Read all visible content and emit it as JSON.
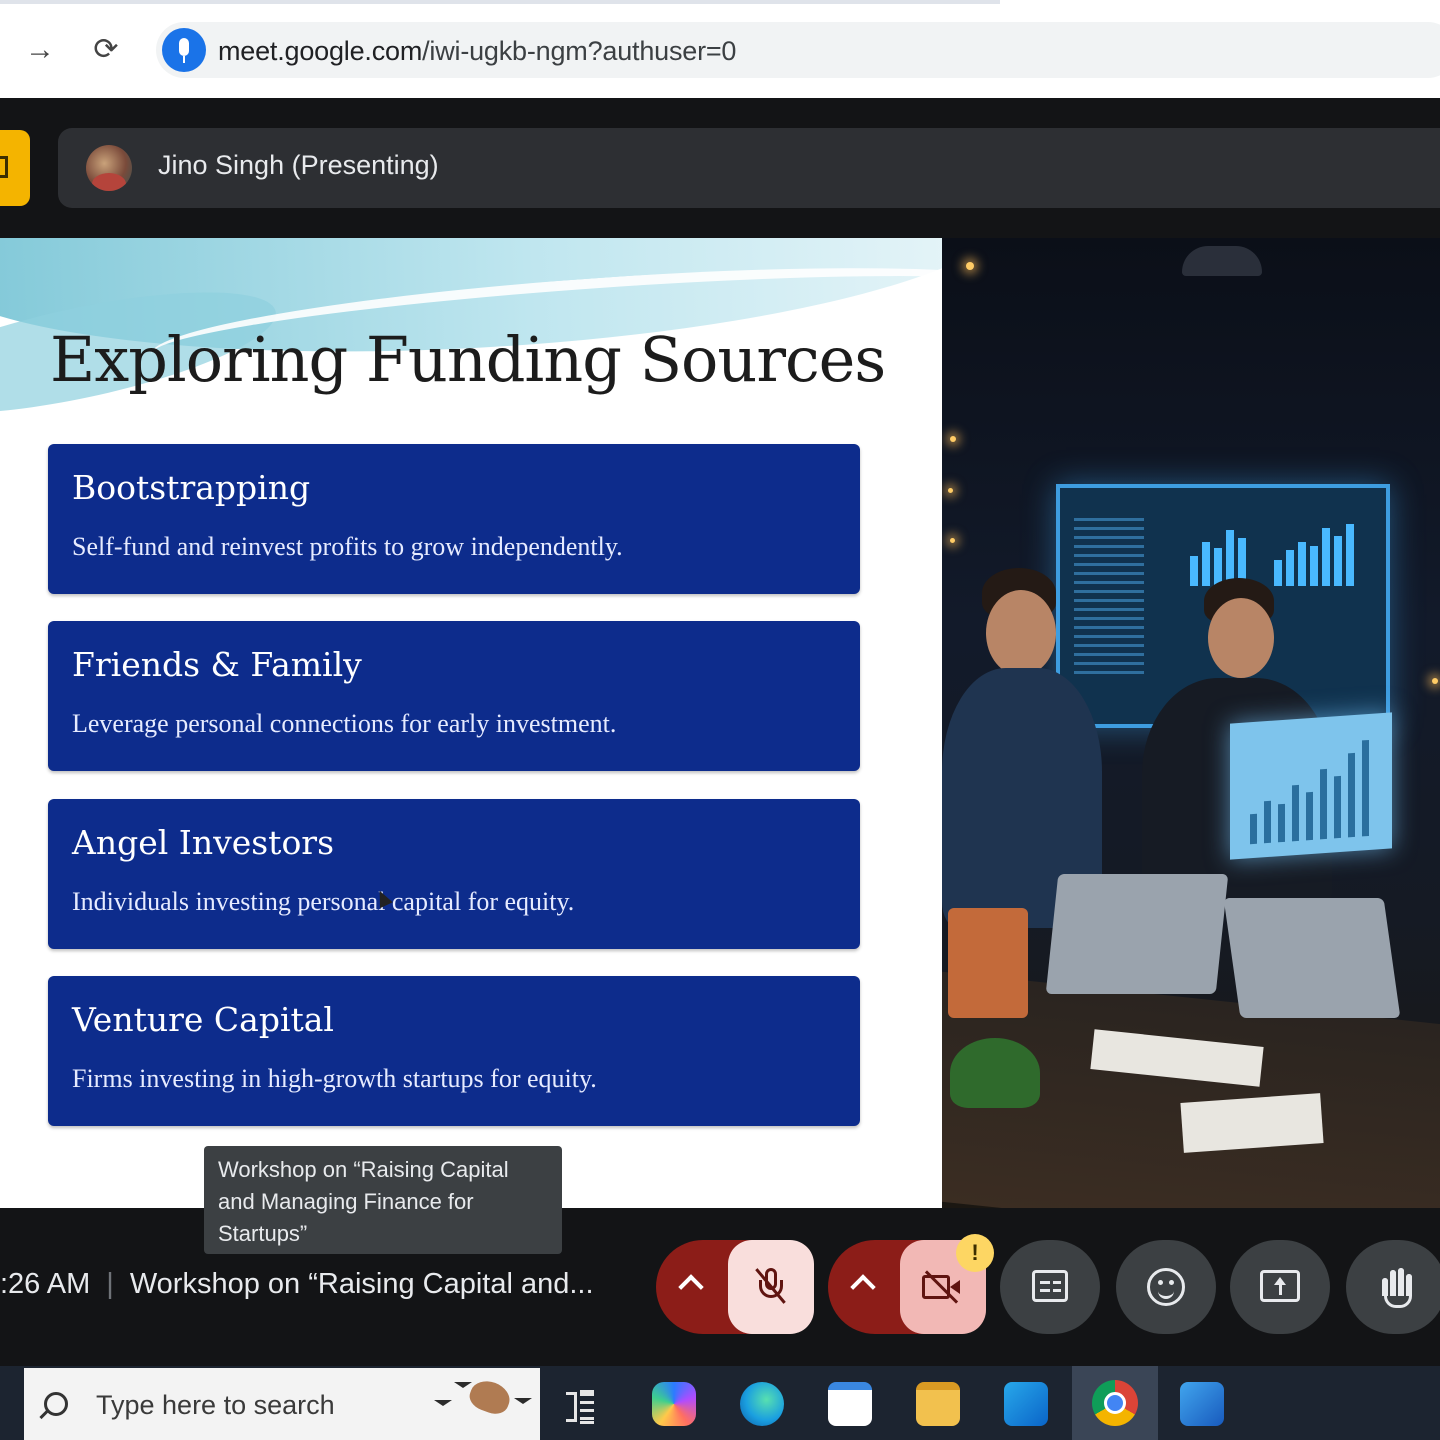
{
  "browser": {
    "url_domain": "meet.google.com",
    "url_path": "/iwi-ugkb-ngm?authuser=0",
    "forward_icon": "arrow-right-icon",
    "reload_icon": "reload-icon",
    "mic_icon": "microphone-icon"
  },
  "meet": {
    "presenter_label": "Jino Singh (Presenting)",
    "time_partial": ":26 AM",
    "separator": "|",
    "meeting_title_truncated": "Workshop on “Raising Capital and...",
    "tooltip_text": "Workshop on “Raising Capital and Managing Finance for Startups”",
    "warning_badge": "!",
    "colors": {
      "mic_cam_group": "#8c1d18",
      "mic_toggle": "#f9dedc",
      "cam_toggle": "#f2b8b5",
      "round_button": "#3c4043",
      "warning": "#fdd663",
      "presenter_tab": "#f4b400"
    }
  },
  "slide": {
    "title": "Exploring Funding Sources",
    "card_color": "#0d2c8c",
    "cards": [
      {
        "title": "Bootstrapping",
        "desc": "Self-fund and reinvest profits to grow independently."
      },
      {
        "title": "Friends & Family",
        "desc": "Leverage personal connections for early investment."
      },
      {
        "title": "Angel Investors",
        "desc": "Individuals investing personal capital for equity."
      },
      {
        "title": "Venture Capital",
        "desc": "Firms investing in high-growth startups for equity."
      }
    ]
  },
  "taskbar": {
    "search_placeholder": "Type here to search",
    "apps": [
      "task-view",
      "copilot",
      "edge",
      "microsoft-store",
      "file-explorer",
      "outlook",
      "chrome",
      "word"
    ]
  }
}
